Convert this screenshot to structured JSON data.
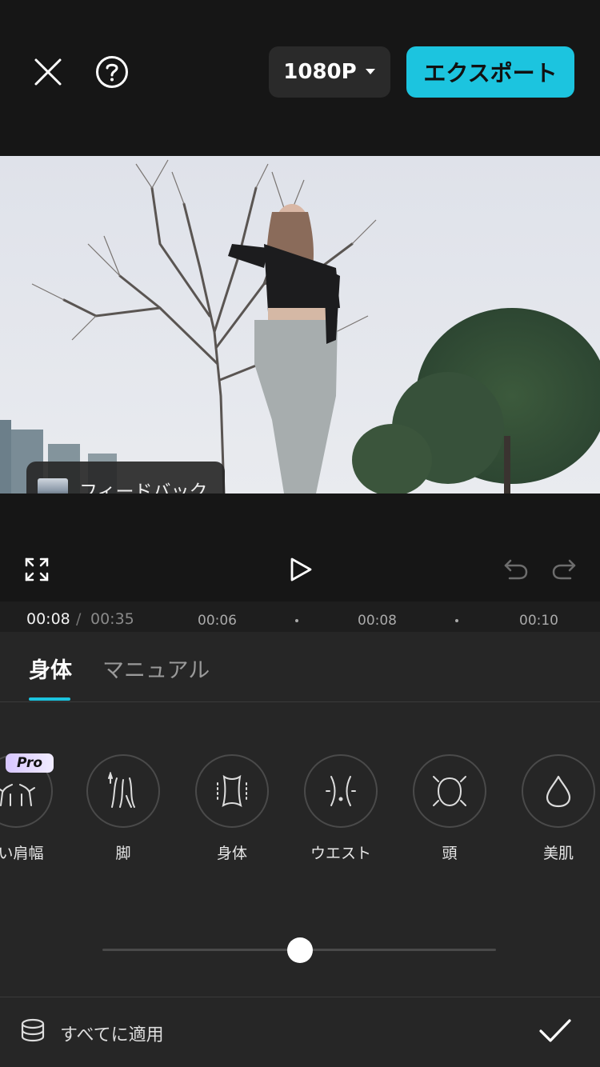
{
  "top_bar": {
    "close_icon": "close-icon",
    "help_icon": "help-icon",
    "resolution": "1080P",
    "export_label": "エクスポート"
  },
  "video": {
    "feedback_label": "フィードバック"
  },
  "controls": {
    "fullscreen_icon": "fullscreen-icon",
    "play_icon": "play-icon",
    "undo_icon": "undo-icon",
    "redo_icon": "redo-icon"
  },
  "timeline": {
    "current": "00:08",
    "separator": "/",
    "total": "00:35",
    "ticks": [
      "00:06",
      "00:08",
      "00:10"
    ]
  },
  "panel": {
    "tabs": [
      {
        "label": "身体",
        "active": true
      },
      {
        "label": "マニュアル",
        "active": false
      }
    ],
    "options": [
      {
        "label": "い肩幅",
        "icon": "shoulder-icon",
        "pro": true
      },
      {
        "label": "脚",
        "icon": "legs-icon",
        "pro": false
      },
      {
        "label": "身体",
        "icon": "body-icon",
        "pro": false
      },
      {
        "label": "ウエスト",
        "icon": "waist-icon",
        "pro": false
      },
      {
        "label": "頭",
        "icon": "head-icon",
        "pro": false
      },
      {
        "label": "美肌",
        "icon": "skin-drop-icon",
        "pro": false
      }
    ],
    "pro_label": "Pro",
    "slider_level": 0.5,
    "apply_all_label": "すべてに適用",
    "confirm_icon": "check-icon"
  },
  "colors": {
    "accent": "#1cc4df",
    "background": "#161616",
    "panel": "#262626"
  }
}
